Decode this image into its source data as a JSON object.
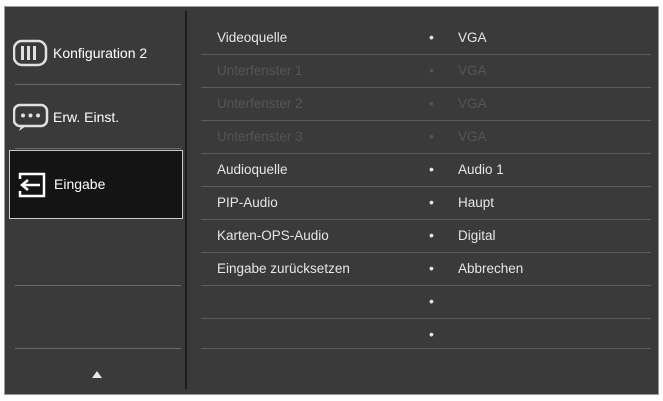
{
  "sidebar": {
    "items": [
      {
        "label": "Konfiguration 2",
        "icon": "slider-icon"
      },
      {
        "label": "Erw. Einst.",
        "icon": "chat-dots-icon"
      },
      {
        "label": "Eingabe",
        "icon": "input-arrow-icon",
        "active": true
      }
    ],
    "scroll_icon": "up-arrow-icon"
  },
  "menu": {
    "rows": [
      {
        "name": "Videoquelle",
        "bullet": "•",
        "value": "VGA",
        "enabled": true
      },
      {
        "name": "Unterfenster 1",
        "bullet": "•",
        "value": "VGA",
        "enabled": false
      },
      {
        "name": "Unterfenster 2",
        "bullet": "•",
        "value": "VGA",
        "enabled": false
      },
      {
        "name": "Unterfenster 3",
        "bullet": "•",
        "value": "VGA",
        "enabled": false
      },
      {
        "name": "Audioquelle",
        "bullet": "•",
        "value": "Audio 1",
        "enabled": true
      },
      {
        "name": "PIP-Audio",
        "bullet": "•",
        "value": "Haupt",
        "enabled": true
      },
      {
        "name": "Karten-OPS-Audio",
        "bullet": "•",
        "value": "Digital",
        "enabled": true
      },
      {
        "name": "Eingabe zurücksetzen",
        "bullet": "•",
        "value": "Abbrechen",
        "enabled": true
      },
      {
        "name": "",
        "bullet": "•",
        "value": "",
        "enabled": true
      },
      {
        "name": "",
        "bullet": "•",
        "value": "",
        "enabled": true
      }
    ]
  },
  "colors": {
    "background": "#3a3a3a",
    "text": "#e6e6e6",
    "disabled_text": "#555555",
    "active_bg": "#141414"
  }
}
